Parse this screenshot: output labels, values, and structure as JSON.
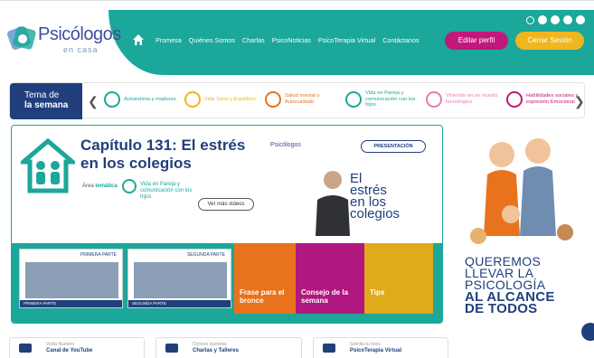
{
  "brand": {
    "name": "Psicólogos",
    "sub": "en casa"
  },
  "nav": {
    "items": [
      "Promesa",
      "Quiénes Somos",
      "Charlas",
      "PsicoNoticias",
      "PsicoTerapia Virtual",
      "Contáctanos"
    ],
    "edit": "Editar perfil",
    "logout": "Cerrar Sesión"
  },
  "tema": {
    "line1": "Tema de",
    "line2": "la semana",
    "topics": [
      {
        "label": "Autoestima y madurez",
        "color": "#1ba79a"
      },
      {
        "label": "Vida Sana y Equilibrio",
        "color": "#f0b61f"
      },
      {
        "label": "Salud mental y Autocuidado",
        "color": "#e8731c"
      },
      {
        "label": "Vida en Pareja y comunicación con los hijos",
        "color": "#1ba79a"
      },
      {
        "label": "Viviendo en un mundo tecnológico",
        "color": "#e87bb5"
      },
      {
        "label": "Habilidades sociales y expresión Emocional",
        "color": "#c2187d"
      }
    ]
  },
  "chapter": {
    "title": "Capítulo 131: El estrés en los colegios",
    "tema_prefix": "Área",
    "tema_bold": "temática",
    "tema_name": "Vida en Pareja y comunicación con los hijos",
    "ver_mas": "Ver más videos"
  },
  "video": {
    "badge": "PRESENTACIÓN",
    "logo": "Psicólogos",
    "title_lines": [
      "El",
      "estrés",
      "en los",
      "colegios"
    ]
  },
  "parts": [
    {
      "label": "PRIMERA PARTE",
      "foot": "PRIMERA PARTE"
    },
    {
      "label": "SEGUNDA PARTE",
      "foot": "SEGUNDA PARTE"
    }
  ],
  "tiles": [
    {
      "label": "Frase para el bronce",
      "color": "#e8731c"
    },
    {
      "label": "Consejo de la semana",
      "color": "#b0177f"
    },
    {
      "label": "Tips",
      "color": "#e0aa1a"
    }
  ],
  "promo": {
    "l1": "QUEREMOS",
    "l2": "LLEVAR LA",
    "l3": "PSICOLOGÍA",
    "l4": "AL ALCANCE",
    "l5": "DE TODOS"
  },
  "links": [
    {
      "sub": "Visita Nuestro",
      "title": "Canal de YouTube"
    },
    {
      "sub": "Conoce nuestras",
      "title": "Charlas y Talleres"
    },
    {
      "sub": "Solicita tu hora",
      "title": "PsicoTerapia Virtual"
    }
  ]
}
